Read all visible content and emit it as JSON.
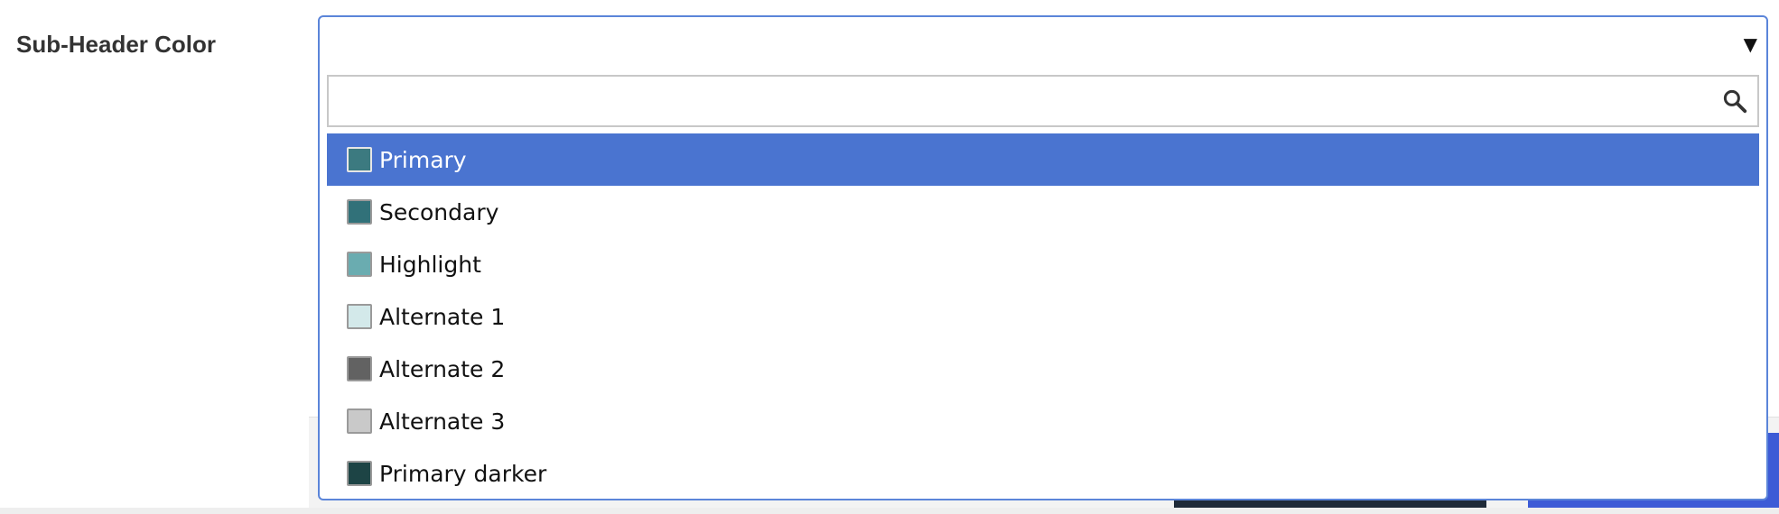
{
  "field": {
    "label": "Sub-Header Color"
  },
  "select": {
    "value": "",
    "arrow_icon": "triangle-down-icon",
    "search": {
      "placeholder": "",
      "value": "",
      "icon": "search-icon"
    },
    "options": [
      {
        "label": "Primary",
        "color": "#3c7a80",
        "highlighted": true
      },
      {
        "label": "Secondary",
        "color": "#317179",
        "highlighted": false
      },
      {
        "label": "Highlight",
        "color": "#6aacb0",
        "highlighted": false
      },
      {
        "label": "Alternate 1",
        "color": "#d3e9ea",
        "highlighted": false
      },
      {
        "label": "Alternate 2",
        "color": "#626262",
        "highlighted": false
      },
      {
        "label": "Alternate 3",
        "color": "#c9c9c9",
        "highlighted": false
      },
      {
        "label": "Primary darker",
        "color": "#1d4445",
        "highlighted": false
      }
    ]
  },
  "colors": {
    "accent_border": "#5b85d9",
    "highlight_bg": "#4a74d0"
  }
}
